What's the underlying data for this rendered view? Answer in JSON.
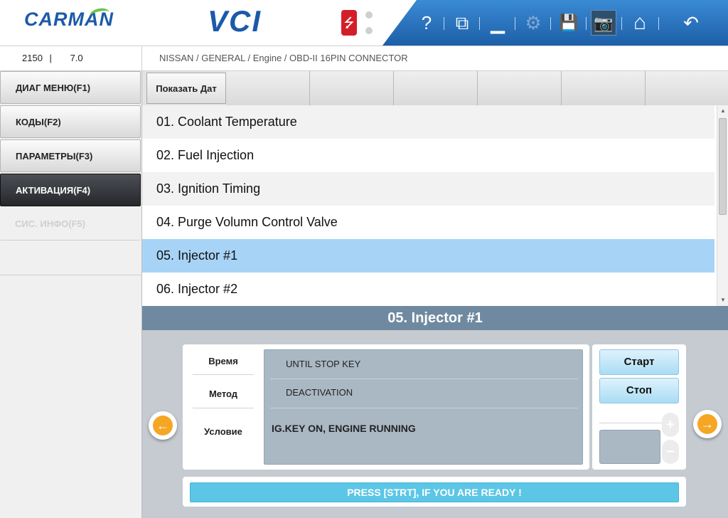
{
  "header": {
    "logo": "CARMAN",
    "product": "VCI",
    "usb_symbol": "⭍",
    "toolbar": {
      "help": "?",
      "windows": "⧉",
      "minimize": "▁",
      "settings": "⚙",
      "save": "💾",
      "camera": "📷",
      "home": "⌂",
      "back": "↶"
    }
  },
  "infobar": {
    "code": "2150",
    "separator": "|",
    "version": "7.0",
    "breadcrumb": "NISSAN / GENERAL / Engine / OBD-II 16PIN CONNECTOR"
  },
  "sidebar": {
    "items": [
      {
        "label": "ДИАГ МЕНЮ(F1)"
      },
      {
        "label": "КОДЫ(F2)"
      },
      {
        "label": "ПАРАМЕТРЫ(F3)"
      },
      {
        "label": "АКТИВАЦИЯ(F4)"
      },
      {
        "label": "СИС. ИНФО(F5)"
      }
    ]
  },
  "tabs": {
    "show_data": "Показать Дат"
  },
  "list": {
    "items": [
      "01. Coolant Temperature",
      "02. Fuel Injection",
      "03. Ignition Timing",
      "04. Purge Volumn Control Valve",
      "05. Injector #1",
      "06. Injector #2"
    ],
    "scroll_up": "▲",
    "scroll_down": "▼"
  },
  "detail": {
    "title": "05. Injector #1",
    "labels": {
      "time": "Время",
      "method": "Метод",
      "condition": "Условие"
    },
    "values": {
      "time": "UNTIL STOP KEY",
      "method": "DEACTIVATION",
      "condition": "IG.KEY ON, ENGINE RUNNING"
    },
    "start_label": "Старт",
    "stop_label": "Стоп",
    "plus": "+",
    "minus": "−",
    "prev_arrow": "←",
    "next_arrow": "→",
    "status": "PRESS [STRT], IF YOU ARE READY !"
  },
  "colors": {
    "accent_blue": "#1c5aa8",
    "selected_row": "#a7d4f6",
    "title_bar": "#6f8aa0",
    "status_bar": "#5cc6e6",
    "arrow_orange": "#f5a623"
  }
}
